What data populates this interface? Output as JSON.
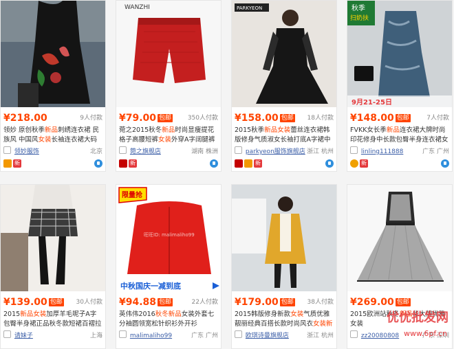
{
  "products": [
    {
      "price": "¥218.00",
      "badge": "",
      "sales": "9人付款",
      "title_parts": [
        "领妙 原创秋季",
        "新品",
        "刺绣连衣裙 民族风 中国风",
        "女装",
        "长袖连衣裙大码"
      ],
      "shop": "领妙服饰",
      "location": "北京",
      "icons": [
        "gold",
        "xin"
      ]
    },
    {
      "price": "¥79.00",
      "badge": "包邮",
      "sales": "350人付款",
      "title_parts": [
        "菀之2015秋冬",
        "新品",
        "时尚显瘦提花格子高腰短裤",
        "女装",
        "外穿A字阔腿裤子"
      ],
      "shop": "菀之旗舰店",
      "location": "湖南 株洲",
      "icons": [
        "tmall",
        "xin"
      ]
    },
    {
      "price": "¥158.00",
      "badge": "包邮",
      "sales": "18人付款",
      "title_parts": [
        "2015秋季",
        "新品女装",
        "蕾丝连衣裙韩版修身气质淑女长袖打底A字裙中裙",
        "",
        " "
      ],
      "shop": "parkyeon服饰旗舰店",
      "location": "浙江 杭州",
      "icons": [
        "tmall",
        "gold",
        "xin"
      ]
    },
    {
      "price": "¥148.00",
      "badge": "包邮",
      "sales": "7人付款",
      "title_parts": [
        "FVKK女长季",
        "新品",
        "连衣裙大牌时尚印花修身中长款包臀半身连衣裙女",
        "",
        ""
      ],
      "shop": "linling111888",
      "location": "广东 广州",
      "icons": [
        "person",
        "xin"
      ]
    },
    {
      "price": "¥139.00",
      "badge": "包邮",
      "sales": "30人付款",
      "title_parts": [
        "2015",
        "新品女装",
        "加厚羊毛呢子A字包臀半身裙正品秋冬款短裙百褶拉链",
        "",
        ""
      ],
      "shop": "请妹子",
      "location": "上海",
      "icons": []
    },
    {
      "price": "¥94.88",
      "badge": "包邮",
      "sales": "22人付款",
      "title_parts": [
        "英伟伟2016",
        "秋冬新品",
        "女装外套七分袖圆领宽松针织衫外开衫S5113",
        "",
        ""
      ],
      "shop": "malimaliho99",
      "location": "广东 广州",
      "icons": []
    },
    {
      "price": "¥179.00",
      "badge": "包邮",
      "sales": "38人付款",
      "title_parts": [
        "2015韩版修身新款",
        "女装",
        "气质优雅靓丽经典百搭长款时尚风衣",
        "女装新品",
        ""
      ],
      "shop": "欧琪诗曼旗舰店",
      "location": "浙江 杭州",
      "icons": []
    },
    {
      "price": "¥269.00",
      "badge": "包邮",
      "sales": "",
      "title_parts": [
        "2015欧洲站秋冬",
        "新品",
        "华大牌优雅女装",
        "",
        ""
      ],
      "shop": "zz20080808",
      "location": "广东 深圳",
      "icons": []
    }
  ],
  "labels": {
    "card3_brand": "PARKYEON",
    "card4_season_top": "秋季",
    "card4_season_bottom": "扫奶扶",
    "card4_date": "9月21-25日",
    "card6_promo": "限量抢",
    "card6_banner": "中秋国庆一减到底",
    "card6_watermark": "旺旺ID: malimaliho99",
    "card2_brand": "WANZHI",
    "watermark_main": "优优批发网",
    "watermark_url": "www.6pf.cn"
  },
  "colors": {
    "price": "#ff4400",
    "accent": "#e4393c",
    "link": "#3b5ea7"
  }
}
